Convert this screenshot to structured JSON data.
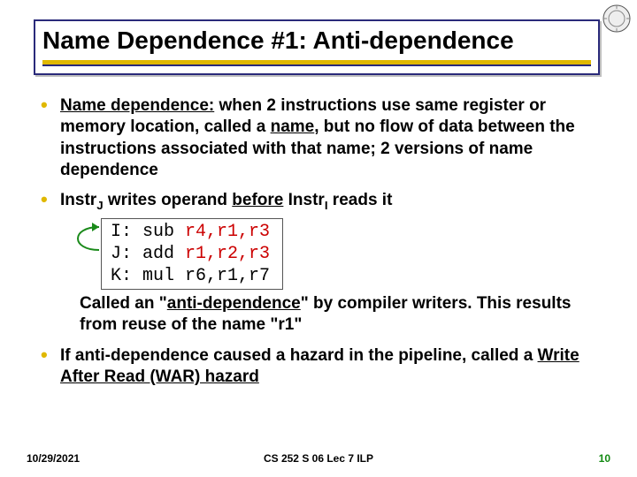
{
  "title": "Name Dependence #1: Anti-dependence",
  "bullets": {
    "b1_pre": "Name dependence:",
    "b1_mid1": " when 2 instructions use same register or memory location, called a ",
    "b1_name": "name",
    "b1_mid2": ", but no flow of data between the instructions associated with that name; ",
    "b1_tail": "2 versions of name dependence",
    "b2_pre": "Instr",
    "b2_subJ": "J",
    "b2_mid1": " writes operand ",
    "b2_before": "before",
    "b2_mid2": " Instr",
    "b2_subI": "I",
    "b2_tail": " reads it",
    "code_l1a": "I: sub ",
    "code_l1b": "r4,",
    "code_l1c": "r1",
    "code_l1d": ",r3",
    "code_l2a": "J: add ",
    "code_l2b": "r1",
    "code_l2c": ",r2,r3",
    "code_l3": "K: mul r6,r1,r7",
    "after1a": "Called an \"",
    "after1b": "anti-dependence",
    "after1c": "\" by compiler writers. This results from reuse of the name \"",
    "after1d": "r1",
    "after1e": "\"",
    "b3a": "If anti-dependence caused a hazard in the pipeline, called a ",
    "b3b": "Write After Read (WAR) hazard"
  },
  "footer": {
    "date": "10/29/2021",
    "center": "CS 252 S 06 Lec 7 ILP",
    "page": "10"
  }
}
